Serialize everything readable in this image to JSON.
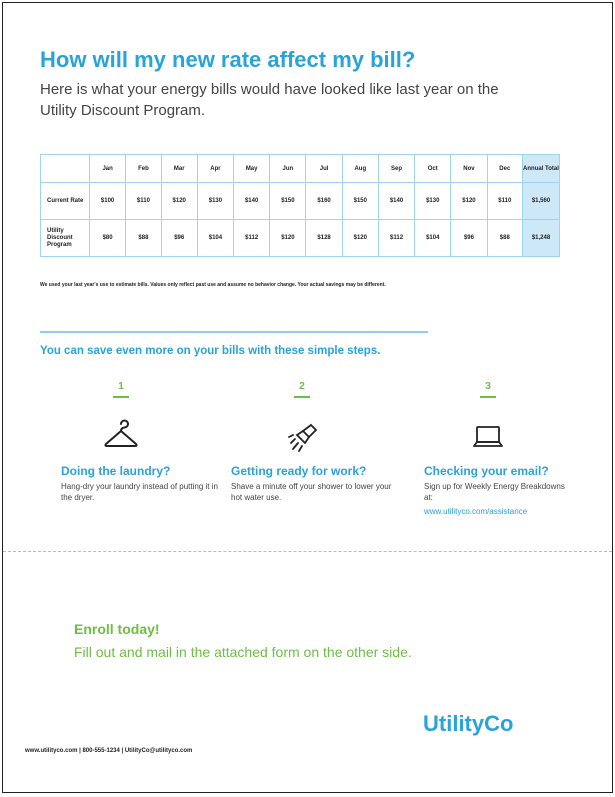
{
  "headline": "How will my new rate affect my bill?",
  "intro": "Here is what your energy bills would have looked like last year on the Utility Discount Program.",
  "table": {
    "corner": "",
    "months": [
      "Jan",
      "Feb",
      "Mar",
      "Apr",
      "May",
      "Jun",
      "Jul",
      "Aug",
      "Sep",
      "Oct",
      "Nov",
      "Dec"
    ],
    "total_header": "Annual Total",
    "rows": [
      {
        "label": "Current Rate",
        "values": [
          "$100",
          "$110",
          "$120",
          "$130",
          "$140",
          "$150",
          "$160",
          "$150",
          "$140",
          "$130",
          "$120",
          "$110"
        ],
        "total": "$1,560"
      },
      {
        "label": "Utility Discount Program",
        "values": [
          "$80",
          "$88",
          "$96",
          "$104",
          "$112",
          "$120",
          "$128",
          "$120",
          "$112",
          "$104",
          "$96",
          "$88"
        ],
        "total": "$1,248"
      }
    ]
  },
  "disclaimer": "We used your last year's use to estimate bills. Values only reflect past use and assume no behavior change. Your actual savings may be different.",
  "subhead": "You can save even more on your bills with these simple steps.",
  "steps": [
    {
      "number": "1",
      "icon": "hanger-icon",
      "title": "Doing the laundry?",
      "text": "Hang-dry your laundry instead of putting it in the dryer."
    },
    {
      "number": "2",
      "icon": "shower-icon",
      "title": "Getting ready for work?",
      "text": "Shave a minute off your shower to lower your hot water use."
    },
    {
      "number": "3",
      "icon": "laptop-icon",
      "title": "Checking your email?",
      "text": "Sign up for Weekly Energy Breakdowns at:",
      "link": "www.utilityco.com/assistance"
    }
  ],
  "enroll": {
    "title": "Enroll today!",
    "text": "Fill out and mail in the attached form on the other side."
  },
  "logo": "UtilityCo",
  "footer": "www.utilityco.com | 800-555-1234 | UtilityCo@utilityco.com",
  "colors": {
    "accent_blue": "#29a3d8",
    "accent_green": "#6dbe45",
    "table_border": "#9fd3ee",
    "total_fill": "#cde9f7"
  }
}
